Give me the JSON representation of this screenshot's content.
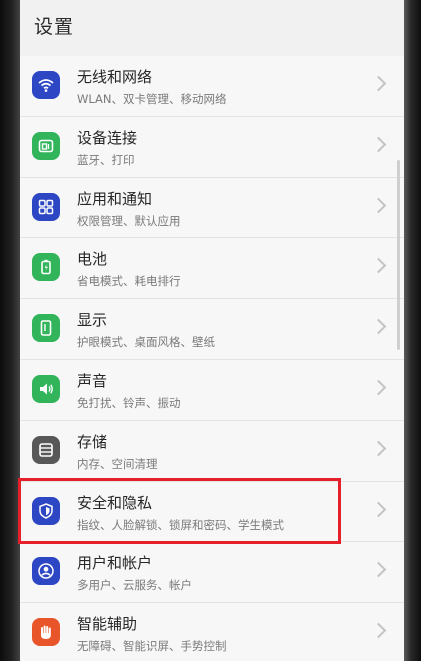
{
  "header": {
    "title": "设置"
  },
  "items": [
    {
      "title": "无线和网络",
      "subtitle": "WLAN、双卡管理、移动网络",
      "icon": "wifi-icon",
      "color": "#2d47c4"
    },
    {
      "title": "设备连接",
      "subtitle": "蓝牙、打印",
      "icon": "device-connect-icon",
      "color": "#31b45a"
    },
    {
      "title": "应用和通知",
      "subtitle": "权限管理、默认应用",
      "icon": "apps-icon",
      "color": "#2d47c4"
    },
    {
      "title": "电池",
      "subtitle": "省电模式、耗电排行",
      "icon": "battery-icon",
      "color": "#31b45a"
    },
    {
      "title": "显示",
      "subtitle": "护眼模式、桌面风格、壁纸",
      "icon": "display-icon",
      "color": "#31b45a"
    },
    {
      "title": "声音",
      "subtitle": "免打扰、铃声、振动",
      "icon": "sound-icon",
      "color": "#31b45a"
    },
    {
      "title": "存储",
      "subtitle": "内存、空间清理",
      "icon": "storage-icon",
      "color": "#585858"
    },
    {
      "title": "安全和隐私",
      "subtitle": "指纹、人脸解锁、锁屏和密码、学生模式",
      "icon": "shield-icon",
      "color": "#2d47c4"
    },
    {
      "title": "用户和帐户",
      "subtitle": "多用户、云服务、帐户",
      "icon": "user-icon",
      "color": "#2d47c4"
    },
    {
      "title": "智能辅助",
      "subtitle": "无障碍、智能识屏、手势控制",
      "icon": "hand-icon",
      "color": "#e8552a"
    }
  ],
  "highlight_color": "#e5202b"
}
